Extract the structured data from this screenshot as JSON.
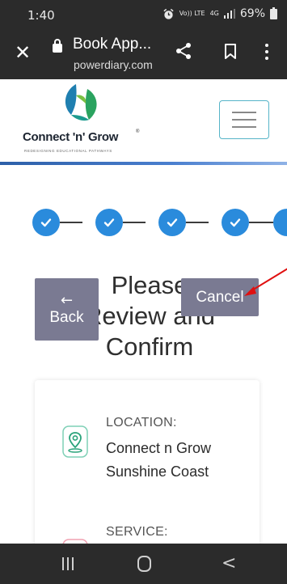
{
  "status_bar": {
    "time": "1:40",
    "network_volte": "Vo)) LTE",
    "network_4g": "4G",
    "battery": "69%"
  },
  "browser": {
    "title": "Book App...",
    "url": "powerdiary.com",
    "icons": [
      "close-icon",
      "lock-icon",
      "share-icon",
      "bookmark-icon",
      "more-vert-icon"
    ]
  },
  "site": {
    "logo_name": "Connect 'n' Grow",
    "logo_reg": "®",
    "logo_tagline": "REDESIGNING EDUCATIONAL PATHWAYS",
    "menu_icon": "hamburger-menu-icon"
  },
  "steps": {
    "count_visible": 5,
    "completed": 5,
    "color": "#2a8bdc"
  },
  "page": {
    "title": "Please Review and Confirm",
    "back_arrow": "←",
    "back_label": "Back",
    "cancel_label": "Cancel",
    "button_color": "#7a7a92"
  },
  "annotation": {
    "arrow_color": "#e01010"
  },
  "summary": {
    "location_label": "LOCATION:",
    "location_value": "Connect n Grow Sunshine Coast",
    "service_label": "SERVICE:"
  },
  "nav_bar": {
    "icons": [
      "recents-icon",
      "home-icon",
      "back-icon"
    ],
    "back_glyph": "<"
  }
}
